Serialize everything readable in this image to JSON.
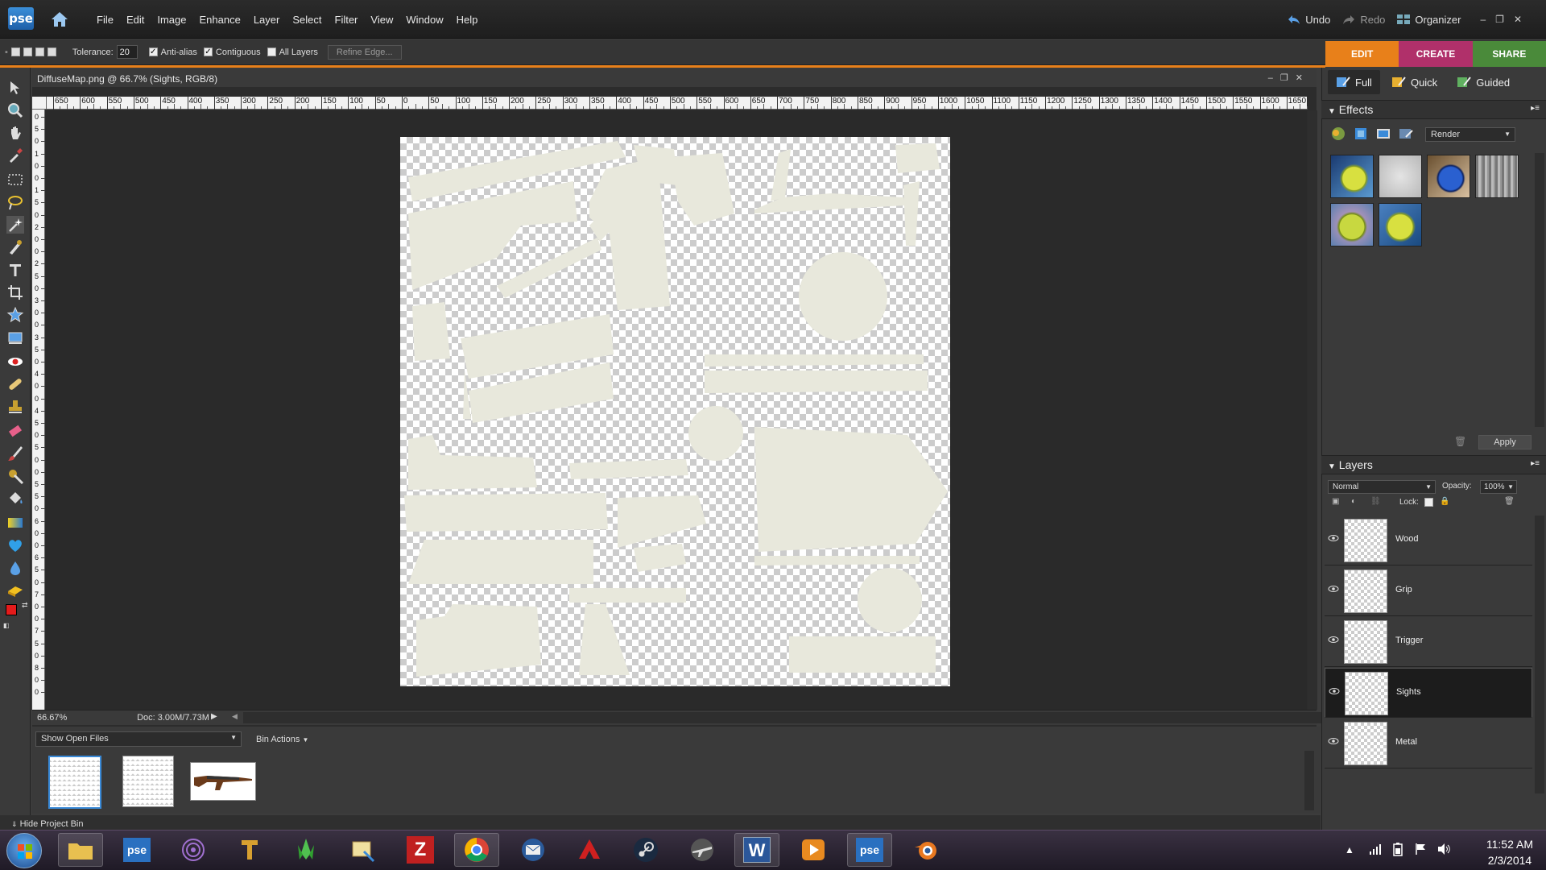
{
  "app": {
    "logo": "pse",
    "menus": [
      "File",
      "Edit",
      "Image",
      "Enhance",
      "Layer",
      "Select",
      "Filter",
      "View",
      "Window",
      "Help"
    ],
    "undo": "Undo",
    "redo": "Redo",
    "organizer": "Organizer"
  },
  "options": {
    "tolerance_label": "Tolerance:",
    "tolerance_value": "20",
    "antialias": "Anti-alias",
    "contiguous": "Contiguous",
    "all_layers": "All Layers",
    "refine_edge": "Refine Edge..."
  },
  "modes": [
    {
      "label": "EDIT",
      "color": "#e8801a"
    },
    {
      "label": "CREATE",
      "color": "#b0306a"
    },
    {
      "label": "SHARE",
      "color": "#4a8a3a"
    }
  ],
  "edit_modes": [
    "Full",
    "Quick",
    "Guided"
  ],
  "document": {
    "title": "DiffuseMap.png @ 66.7% (Sights, RGB/8)",
    "zoom": "66.67%",
    "doc_size": "Doc: 3.00M/7.73M"
  },
  "ruler_h": [
    "650",
    "600",
    "550",
    "500",
    "450",
    "400",
    "350",
    "300",
    "250",
    "200",
    "150",
    "100",
    "50",
    "0",
    "50",
    "100",
    "150",
    "200",
    "250",
    "300",
    "350",
    "400",
    "450",
    "500",
    "550",
    "600",
    "650",
    "700",
    "750",
    "800",
    "850",
    "900",
    "950",
    "1000",
    "1050",
    "1100",
    "1150",
    "1200",
    "1250",
    "1300",
    "1350",
    "1400",
    "1450",
    "1500",
    "1550",
    "1600",
    "1650"
  ],
  "ruler_v": [
    "0",
    "5",
    "0",
    "1",
    "0",
    "0",
    "1",
    "5",
    "0",
    "2",
    "0",
    "0",
    "2",
    "5",
    "0",
    "3",
    "0",
    "0",
    "3",
    "5",
    "0",
    "4",
    "0",
    "0",
    "4",
    "5",
    "0",
    "5",
    "0",
    "0",
    "5",
    "5",
    "0",
    "6",
    "0",
    "0",
    "6",
    "5",
    "0",
    "7",
    "0",
    "0",
    "7",
    "5",
    "0",
    "8",
    "0",
    "0"
  ],
  "bin": {
    "show": "Show Open Files",
    "actions": "Bin Actions",
    "hide": "Hide Project Bin"
  },
  "effects": {
    "title": "Effects",
    "category": "Render",
    "apply": "Apply"
  },
  "layers": {
    "title": "Layers",
    "blend": "Normal",
    "opacity_label": "Opacity:",
    "opacity": "100%",
    "lock": "Lock:",
    "items": [
      "Wood",
      "Grip",
      "Trigger",
      "Sights",
      "Metal"
    ],
    "selected": "Sights"
  },
  "taskbar": {
    "time": "11:52 AM",
    "date": "2/3/2014"
  },
  "colors": {
    "foreground": "#e41b1b",
    "background": "#f2b81c",
    "uv_shape": "#e8e8dc"
  }
}
